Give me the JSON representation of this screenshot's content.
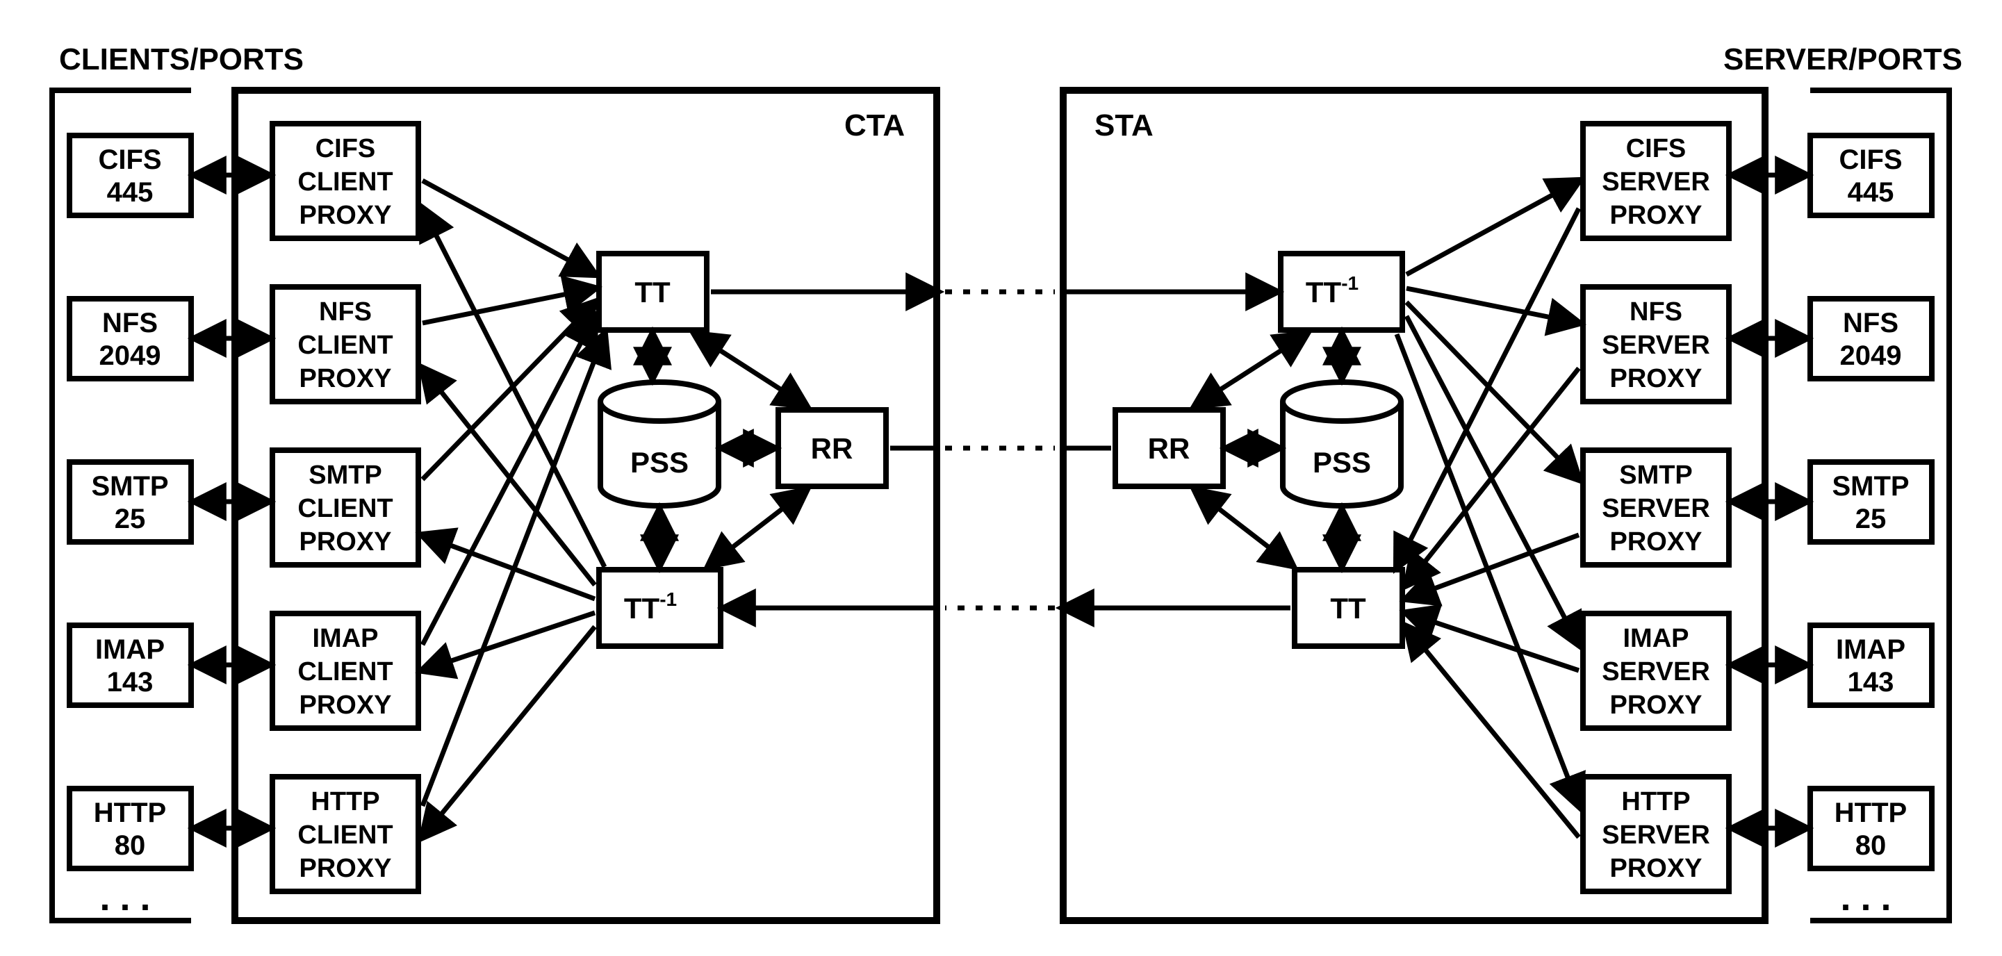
{
  "headers": {
    "left": "CLIENTS/PORTS",
    "right": "SERVER/PORTS"
  },
  "ports": {
    "cifs": {
      "name": "CIFS",
      "num": "445"
    },
    "nfs": {
      "name": "NFS",
      "num": "2049"
    },
    "smtp": {
      "name": "SMTP",
      "num": "25"
    },
    "imap": {
      "name": "IMAP",
      "num": "143"
    },
    "http": {
      "name": "HTTP",
      "num": "80"
    }
  },
  "proxies": {
    "client": {
      "cifs": {
        "l1": "CIFS",
        "l2": "CLIENT",
        "l3": "PROXY"
      },
      "nfs": {
        "l1": "NFS",
        "l2": "CLIENT",
        "l3": "PROXY"
      },
      "smtp": {
        "l1": "SMTP",
        "l2": "CLIENT",
        "l3": "PROXY"
      },
      "imap": {
        "l1": "IMAP",
        "l2": "CLIENT",
        "l3": "PROXY"
      },
      "http": {
        "l1": "HTTP",
        "l2": "CLIENT",
        "l3": "PROXY"
      }
    },
    "server": {
      "cifs": {
        "l1": "CIFS",
        "l2": "SERVER",
        "l3": "PROXY"
      },
      "nfs": {
        "l1": "NFS",
        "l2": "SERVER",
        "l3": "PROXY"
      },
      "smtp": {
        "l1": "SMTP",
        "l2": "SERVER",
        "l3": "PROXY"
      },
      "imap": {
        "l1": "IMAP",
        "l2": "SERVER",
        "l3": "PROXY"
      },
      "http": {
        "l1": "HTTP",
        "l2": "SERVER",
        "l3": "PROXY"
      }
    }
  },
  "inner": {
    "cta": "CTA",
    "sta": "STA",
    "tt": "TT",
    "ttinv_base": "TT",
    "ttinv_sup": "-1",
    "pss": "PSS",
    "rr": "RR"
  }
}
